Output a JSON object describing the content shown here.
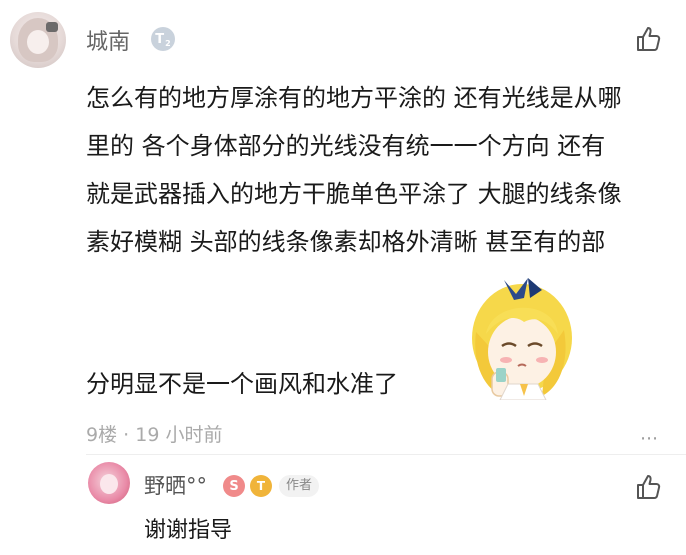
{
  "comment": {
    "username": "城南",
    "level_badge": "T",
    "level_num": "2",
    "lines": [
      "怎么有的地方厚涂有的地方平涂的  还有光线是从哪",
      "里的  各个身体部分的光线没有统一一个方向  还有",
      "就是武器插入的地方干脆单色平涂了  大腿的线条像",
      "素好模糊  头部的线条像素却格外清晰  甚至有的部"
    ],
    "last_line": "分明显不是一个画风和水准了",
    "floor": "9楼",
    "separator": "·",
    "time": "19 小时前",
    "more_icon": "⋯",
    "like_icon": "thumb-up-icon"
  },
  "reply": {
    "username": "野晒°°",
    "badge1": "S",
    "badge2": "T",
    "author_tag": "作者",
    "text": "谢谢指导",
    "like_icon": "thumb-up-icon"
  },
  "colors": {
    "username": "#666666",
    "meta": "#aaaaaa",
    "level_badge": "#c9d2dc",
    "badge_pink": "#f08a8a",
    "badge_gold": "#f0b43a"
  }
}
